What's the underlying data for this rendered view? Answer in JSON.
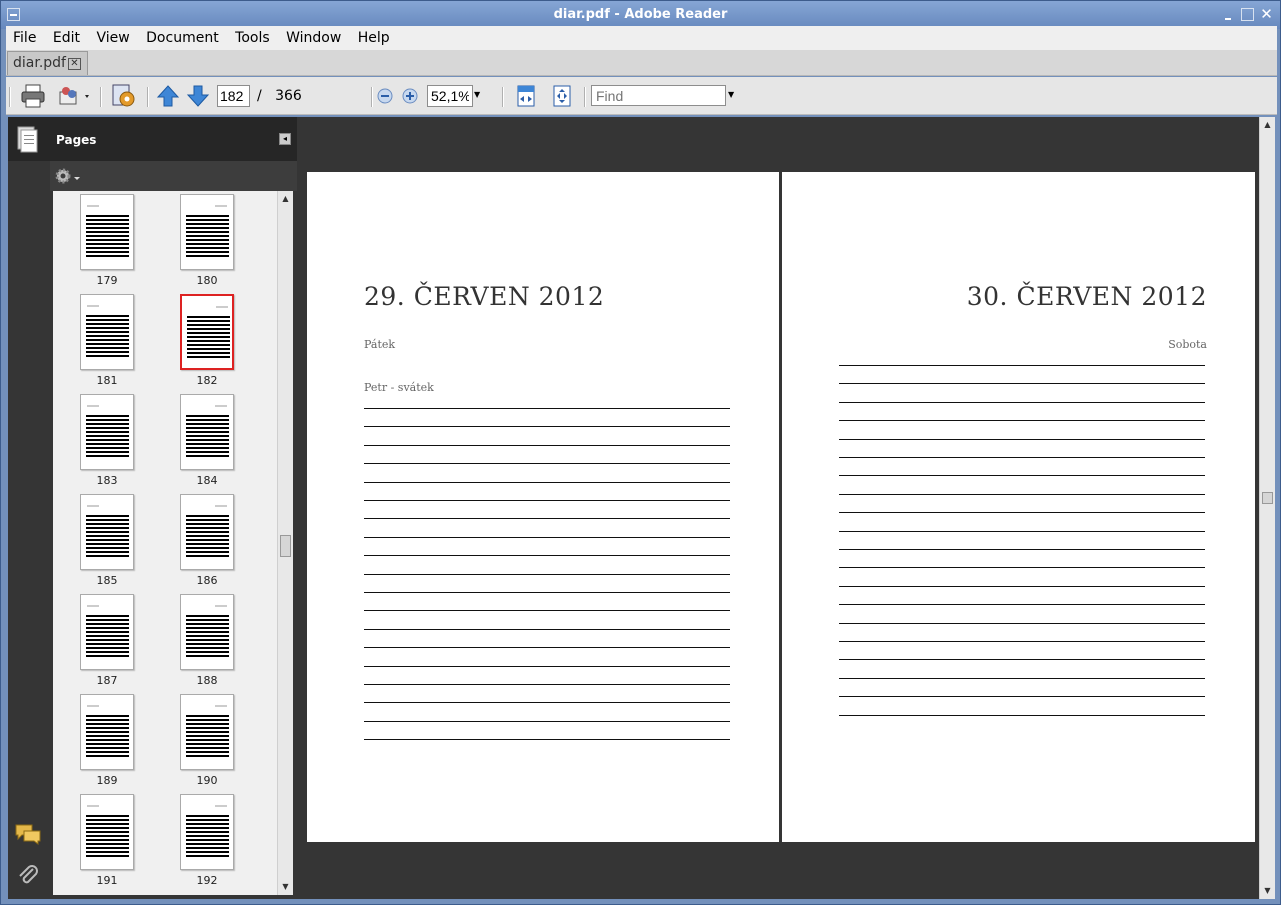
{
  "window": {
    "title": "diar.pdf - Adobe Reader"
  },
  "menubar": {
    "items": [
      "File",
      "Edit",
      "View",
      "Document",
      "Tools",
      "Window",
      "Help"
    ]
  },
  "tabs": [
    {
      "label": "diar.pdf"
    }
  ],
  "toolbar": {
    "current_page": "182",
    "page_separator": "/",
    "total_pages": "366",
    "zoom": "52,1%",
    "find_placeholder": "Find"
  },
  "pages_panel": {
    "title": "Pages",
    "thumbnails": [
      {
        "num": "179",
        "selected": false
      },
      {
        "num": "180",
        "selected": false
      },
      {
        "num": "181",
        "selected": false
      },
      {
        "num": "182",
        "selected": true
      },
      {
        "num": "183",
        "selected": false
      },
      {
        "num": "184",
        "selected": false
      },
      {
        "num": "185",
        "selected": false
      },
      {
        "num": "186",
        "selected": false
      },
      {
        "num": "187",
        "selected": false
      },
      {
        "num": "188",
        "selected": false
      },
      {
        "num": "189",
        "selected": false
      },
      {
        "num": "190",
        "selected": false
      },
      {
        "num": "191",
        "selected": false
      },
      {
        "num": "192",
        "selected": false
      }
    ]
  },
  "document": {
    "left_page": {
      "title": "29. ČERVEN 2012",
      "day": "Pátek",
      "note": "Petr - svátek",
      "line_count": 19
    },
    "right_page": {
      "title": "30. ČERVEN 2012",
      "day": "Sobota",
      "line_count": 20
    }
  },
  "colors": {
    "selection": "#dd2222",
    "panel_bg": "#353535",
    "titlebar": "#6f8fc2"
  }
}
